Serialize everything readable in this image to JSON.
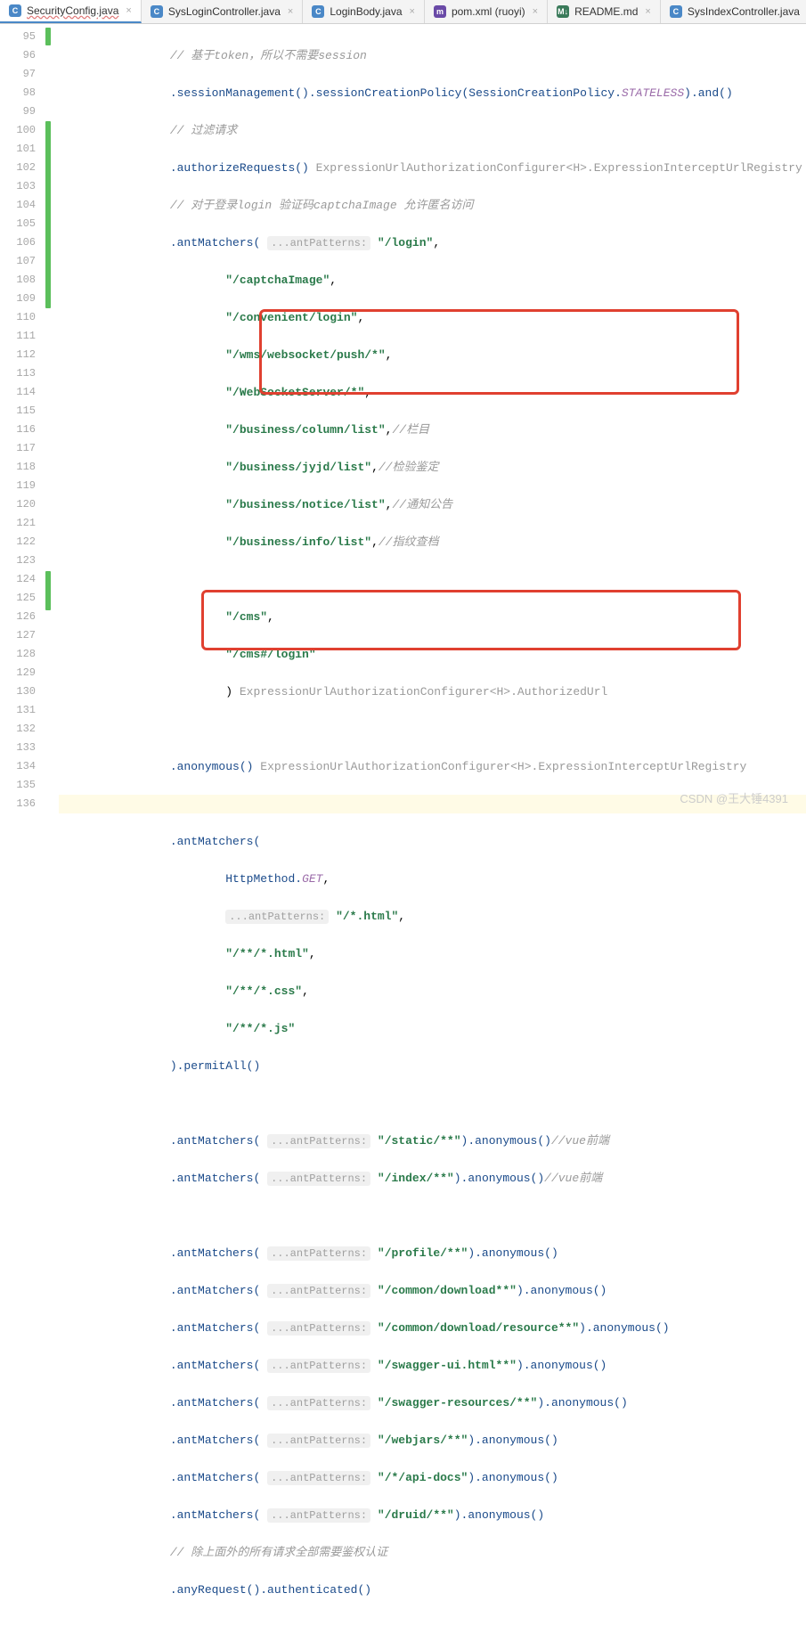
{
  "tabs": [
    {
      "icon": "C",
      "cls": "ico-c",
      "label": "SecurityConfig.java",
      "active": true,
      "underline": true
    },
    {
      "icon": "C",
      "cls": "ico-c",
      "label": "SysLoginController.java"
    },
    {
      "icon": "C",
      "cls": "ico-c",
      "label": "LoginBody.java"
    },
    {
      "icon": "m",
      "cls": "ico-m",
      "label": "pom.xml (ruoyi)"
    },
    {
      "icon": "M",
      "cls": "ico-md",
      "label": "README.md"
    },
    {
      "icon": "C",
      "cls": "ico-c",
      "label": "SysIndexController.java"
    }
  ],
  "lines": {
    "l95": "// 基于token，所以不需要session",
    "l96a": ".sessionManagement().sessionCreationPolicy(SessionCreationPolicy.",
    "l96b": "STATELESS",
    "l96c": ").and()",
    "l97": "// 过滤请求",
    "l98a": ".authorizeRequests()",
    "l98b": "ExpressionUrlAuthorizationConfigurer<H>.ExpressionInterceptUrlRegistry",
    "l99": "// 对于登录login 验证码captchaImage 允许匿名访问",
    "l100a": ".antMatchers(",
    "l100h": "...antPatterns:",
    "l100b": "\"/login\"",
    "l100c": ",",
    "l101": "\"/captchaImage\"",
    "c": ",",
    "l102": "\"/convenient/login\"",
    "l103": "\"/wms/websocket/push/*\"",
    "l104": "\"/WebSocketServer/*\"",
    "l105": "\"/business/column/list\"",
    "l105c": "//栏目",
    "l106": "\"/business/jyjd/list\"",
    "l106c": "//检验鉴定",
    "l107": "\"/business/notice/list\"",
    "l107c": "//通知公告",
    "l108": "\"/business/info/list\"",
    "l108c": "//指纹查档",
    "l110": "\"/cms\"",
    "l111": "\"/cms#/login\"",
    "l112a": ")",
    "l112b": "ExpressionUrlAuthorizationConfigurer<H>.AuthorizedUrl",
    "l114a": ".anonymous()",
    "l114b": "ExpressionUrlAuthorizationConfigurer<H>.ExpressionInterceptUrlRegistry",
    "l116": ".antMatchers(",
    "l117a": "HttpMethod.",
    "l117b": "GET",
    "l117c": ",",
    "l118h": "...antPatterns:",
    "l118": "\"/*.html\"",
    "l119": "\"/**/*.html\"",
    "l120": "\"/**/*.css\"",
    "l121": "\"/**/*.js\"",
    "l122": ").permitAll()",
    "l124a": ".antMatchers(",
    "l124h": "...antPatterns:",
    "l124b": "\"/static/**\"",
    "l124c": ").anonymous()",
    "l124d": "//vue前端",
    "l125b": "\"/index/**\"",
    "l125d": "//vue前端",
    "l127b": "\"/profile/**\"",
    "l127c": ").anonymous()",
    "l128b": "\"/common/download**\"",
    "l129b": "\"/common/download/resource**\"",
    "l130b": "\"/swagger-ui.html**\"",
    "l131b": "\"/swagger-resources/**\"",
    "l132b": "\"/webjars/**\"",
    "l133b": "\"/*/api-docs\"",
    "l134b": "\"/druid/**\"",
    "l135": "// 除上面外的所有请求全部需要鉴权认证",
    "l136": ".anyRequest().authenticated()"
  },
  "lineStart": 95,
  "lineEnd": 136,
  "watermark": "CSDN @王大锤4391"
}
